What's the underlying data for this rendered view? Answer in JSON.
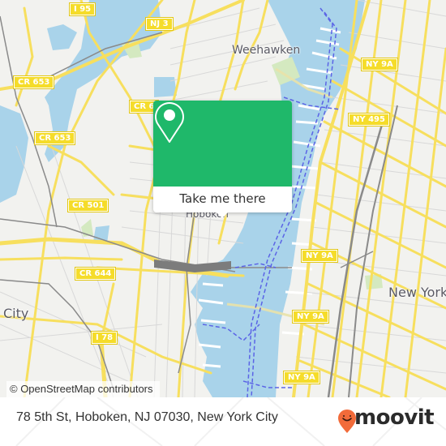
{
  "map": {
    "colors": {
      "water": "#a9d3ea",
      "land": "#f2f2ef",
      "road_major": "#f7df5e",
      "road_minor": "#d6d6d6",
      "rail": "#8a8a8a",
      "ferry": "#5b64e6",
      "park": "#d4e9c0"
    },
    "shields": [
      {
        "label": "I 95"
      },
      {
        "label": "NJ 3"
      },
      {
        "label": "CR 653"
      },
      {
        "label": "CR 653"
      },
      {
        "label": "CR 6"
      },
      {
        "label": "CR 501"
      },
      {
        "label": "CR 644"
      },
      {
        "label": "I 78"
      },
      {
        "label": "NY 9A"
      },
      {
        "label": "NY 495"
      },
      {
        "label": "NY 9A"
      },
      {
        "label": "NY 9A"
      },
      {
        "label": "NY 9A"
      }
    ],
    "places": [
      {
        "label": "Weehawken"
      },
      {
        "label": "Hoboken"
      },
      {
        "label": "New York"
      },
      {
        "label": "City"
      }
    ],
    "attribution": "© OpenStreetMap contributors"
  },
  "popup": {
    "icon": "map-pin-icon",
    "button_label": "Take me there",
    "header_color": "#1fb86a"
  },
  "footer": {
    "address": "78 5th St, Hoboken, NJ 07030, New York City",
    "brand": "moovit",
    "brand_color": "#f26b3a"
  }
}
